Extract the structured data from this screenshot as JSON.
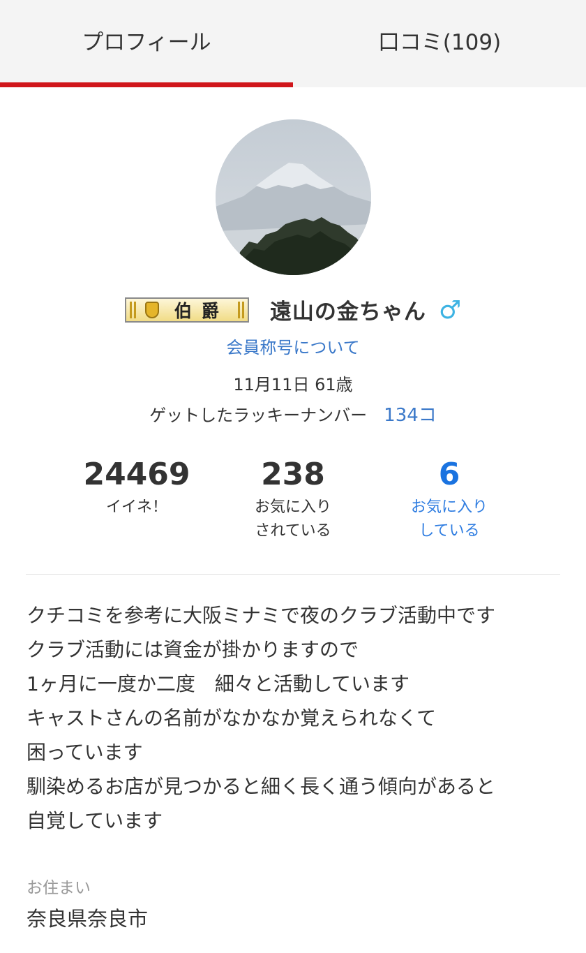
{
  "tabs": [
    {
      "label": "プロフィール",
      "active": true
    },
    {
      "label": "口コミ(109)",
      "active": false
    }
  ],
  "profile": {
    "rank_title": "伯爵",
    "username": "遠山の金ちゃん",
    "gender_icon": "male-symbol-icon",
    "gender_symbol": "♂",
    "title_link": "会員称号について",
    "birthday_age": "11月11日 61歳",
    "lucky_label": "ゲットしたラッキーナンバー",
    "lucky_count": "134コ"
  },
  "stats": [
    {
      "value": "24469",
      "label_line1": "イイネ！",
      "label_line2": ""
    },
    {
      "value": "238",
      "label_line1": "お気に入り",
      "label_line2": "されている"
    },
    {
      "value": "6",
      "label_line1": "お気に入り",
      "label_line2": "している"
    }
  ],
  "bio_lines": [
    "クチコミを参考に大阪ミナミで夜のクラブ活動中です",
    "クラブ活動には資金が掛かりますので",
    "1ヶ月に一度か二度　細々と活動しています",
    "キャストさんの名前がなかなか覚えられなくて",
    "困っています",
    "馴染めるお店が見つかると細く長く通う傾向があると",
    "自覚しています"
  ],
  "residence": {
    "label": "お住まい",
    "value": "奈良県奈良市"
  },
  "colors": {
    "accent_red": "#d0161b",
    "link_blue": "#3a78c9",
    "gender_blue": "#3db3e3"
  }
}
